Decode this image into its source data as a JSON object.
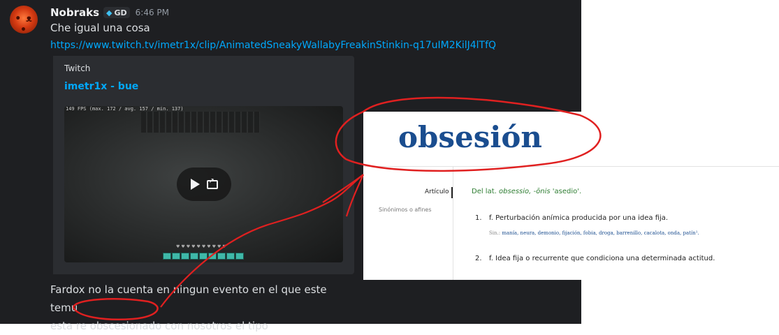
{
  "message": {
    "username": "Nobraks",
    "tag": "GD",
    "timestamp": "6:46 PM",
    "text": "Che igual una cosa",
    "link": "https://www.twitch.tv/imetr1x/clip/AnimatedSneakyWallabyFreakinStinkin-q17uIM2KilJ4lTfQ"
  },
  "embed": {
    "provider": "Twitch",
    "title": "imetr1x - bue",
    "fps_overlay": "149 FPS (max. 172 / avg. 157 / min. 137)"
  },
  "reply": {
    "line1": "Fardox no la cuenta en ningun evento en el que este temu",
    "line2": "esta re obscesionado con nosotros el tipo"
  },
  "dictionary": {
    "word": "obsesión",
    "nav_article": "Artículo",
    "nav_synonyms": "Sinónimos o afines",
    "etymology_prefix": "Del lat.",
    "etymology_word": "obsessio, -ōnis",
    "etymology_meaning": "'asedio'.",
    "definitions": [
      {
        "num": "1.",
        "text": "f. Perturbación anímica producida por una idea fija."
      },
      {
        "num": "2.",
        "text": "f. Idea fija o recurrente que condiciona una determinada actitud."
      }
    ],
    "synonyms_label": "Sin.:",
    "synonyms": "manía, neura, demonio, fijación, fobia, droga, barrenillo, cacalota, onda, patín¹."
  },
  "colors": {
    "chat_bg": "#1e1f22",
    "embed_bg": "#2b2d31",
    "link": "#00a8fc",
    "dict_word": "#1a4d8f",
    "annotation": "#e02020"
  },
  "icons": [
    "play-icon",
    "open-external-icon",
    "nitro-gem-icon"
  ]
}
